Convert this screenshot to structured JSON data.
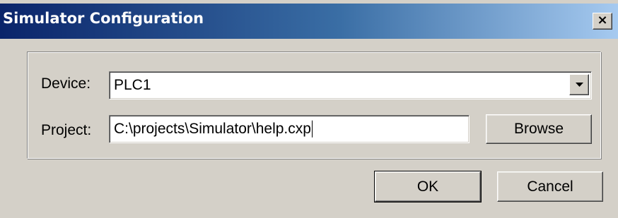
{
  "window": {
    "title": "Simulator Configuration",
    "close_symbol": "×"
  },
  "form": {
    "device_label": "Device:",
    "device_value": "PLC1",
    "project_label": "Project:",
    "project_value": "C:\\projects\\Simulator\\help.cxp",
    "browse_label": "Browse"
  },
  "footer": {
    "ok_label": "OK",
    "cancel_label": "Cancel"
  },
  "icons": {
    "dropdown": "chevron-down-icon",
    "close": "close-icon"
  },
  "colors": {
    "titlebar_start": "#0a246a",
    "titlebar_end": "#a6caf0",
    "face": "#d4d0c8"
  }
}
